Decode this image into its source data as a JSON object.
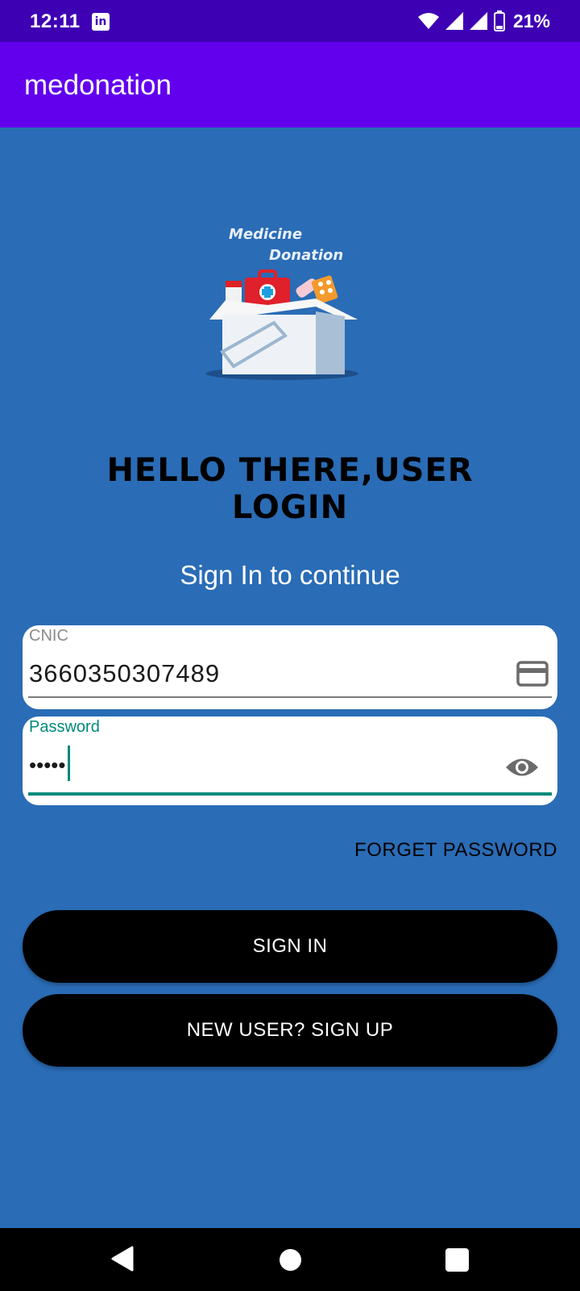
{
  "status_bar": {
    "time": "12:11",
    "notification_icon": "linkedin-icon",
    "battery_percent": "21%"
  },
  "app_bar": {
    "title": "medonation"
  },
  "logo": {
    "line1": "Medicine",
    "line2": "Donation"
  },
  "login": {
    "heading_line1": "HELLO THERE,USER",
    "heading_line2": "LOGIN",
    "subheading": "Sign In to continue",
    "cnic": {
      "label": "CNIC",
      "value": "3660350307489",
      "icon": "card-icon"
    },
    "password": {
      "label": "Password",
      "masked_value": "•••••",
      "icon": "eye-icon"
    },
    "forget_password": "FORGET PASSWORD",
    "sign_in": "SIGN IN",
    "sign_up": "NEW USER? SIGN UP"
  },
  "colors": {
    "background": "#2a6cb6",
    "status_bar": "#3e00b3",
    "app_bar": "#6200ee",
    "accent": "#00897b",
    "button": "#000000"
  }
}
